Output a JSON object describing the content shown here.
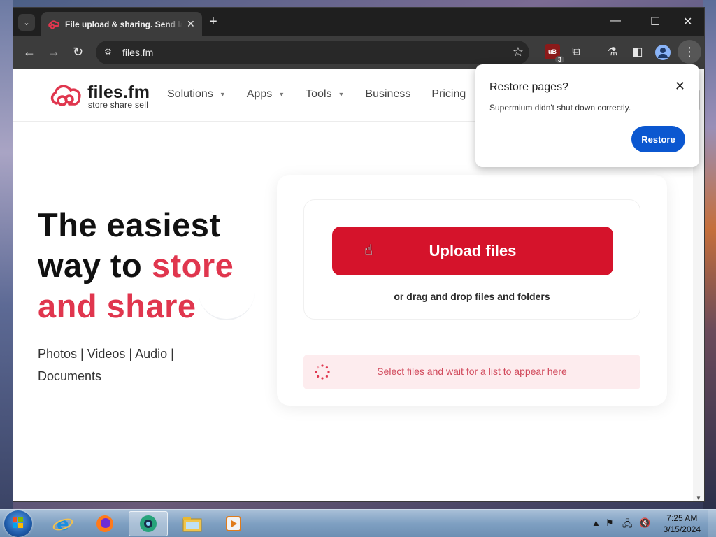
{
  "browser": {
    "tab_title": "File upload & sharing. Send large files",
    "tab_close": "✕",
    "new_tab": "+",
    "url": "files.fm",
    "extension_badge": "3",
    "window_controls": {
      "minimize": "—",
      "maximize": "☐",
      "close": "✕"
    }
  },
  "site": {
    "logo_name": "files.fm",
    "logo_tagline": "store share sell",
    "nav": [
      {
        "label": "Solutions",
        "has_caret": true
      },
      {
        "label": "Apps",
        "has_caret": true
      },
      {
        "label": "Tools",
        "has_caret": true
      },
      {
        "label": "Business",
        "has_caret": false
      },
      {
        "label": "Pricing",
        "has_caret": false
      }
    ],
    "hero": {
      "line1": "The easiest",
      "line2_plain": "way to ",
      "line2_accent": "store",
      "line3_accent": "and share",
      "subtitle_line1": "Photos | Videos | Audio |",
      "subtitle_line2": "Documents"
    },
    "upload": {
      "button_label": "Upload files",
      "drag_text": "or drag and drop files and folders",
      "list_placeholder": "Select files and wait for a list to appear here"
    }
  },
  "popup": {
    "title": "Restore pages?",
    "message": "Supermium didn't shut down correctly.",
    "button": "Restore"
  },
  "taskbar": {
    "time": "7:25 AM",
    "date": "3/15/2024",
    "apps": [
      "ie-icon",
      "firefox-icon",
      "browser-icon",
      "file-explorer-icon",
      "media-player-icon"
    ]
  },
  "colors": {
    "brand_red": "#d5132b",
    "accent_red": "#e0364e",
    "restore_blue": "#0b57d0"
  }
}
